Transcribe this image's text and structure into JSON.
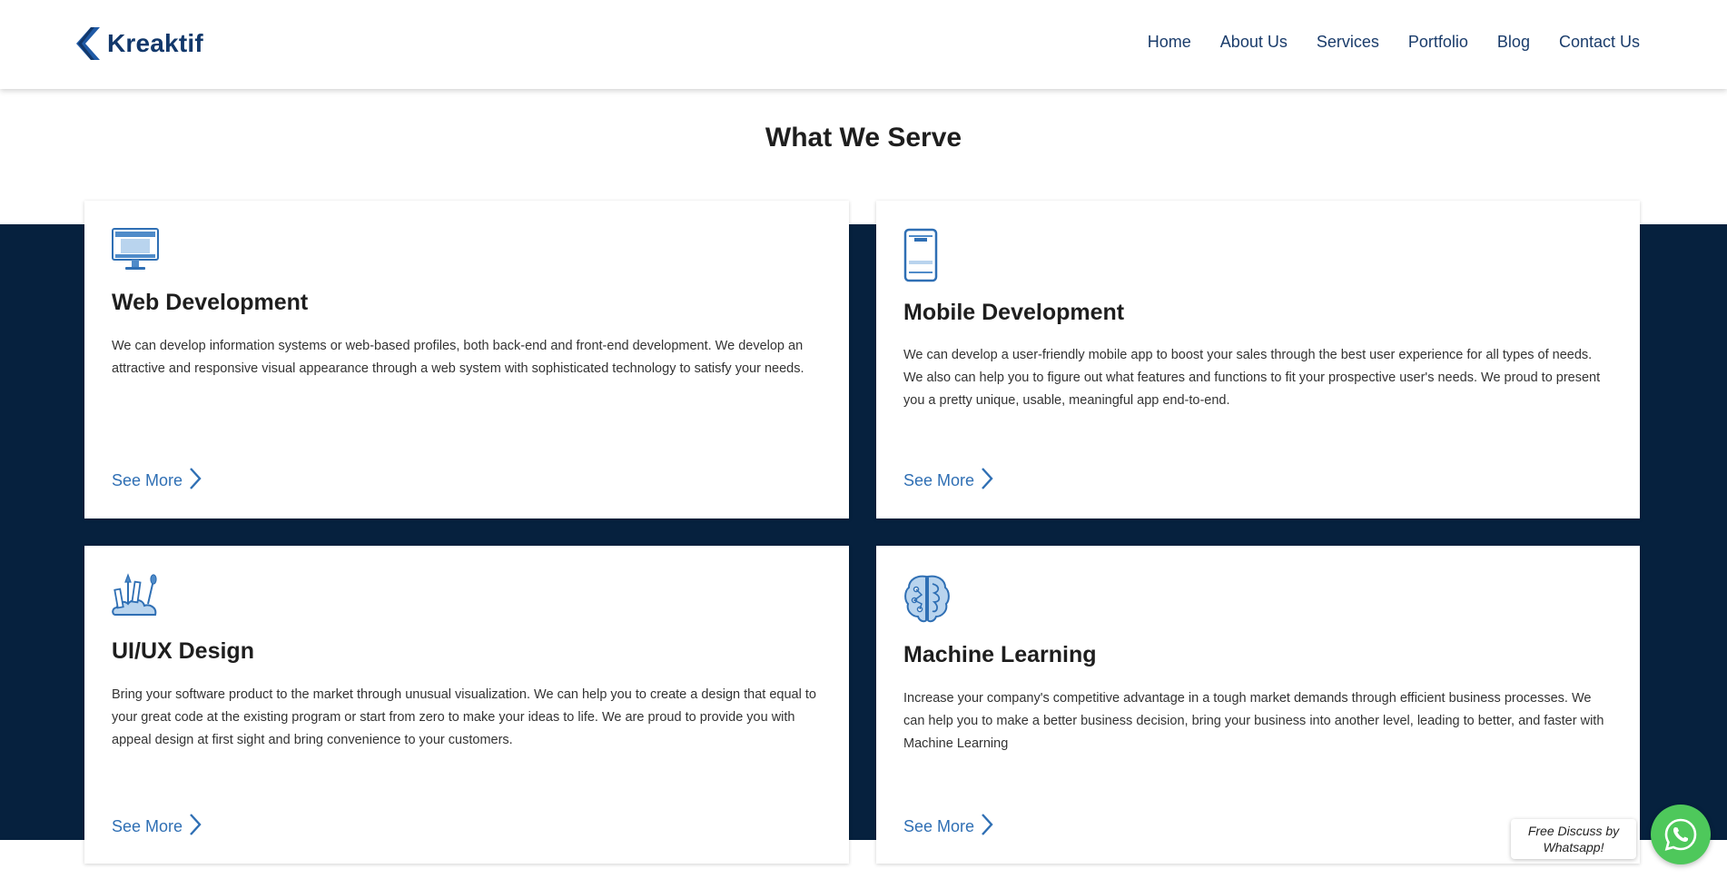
{
  "header": {
    "logo_text": "Kreaktif",
    "nav": [
      "Home",
      "About Us",
      "Services",
      "Portfolio",
      "Blog",
      "Contact Us"
    ]
  },
  "section": {
    "title": "What We Serve"
  },
  "cards": [
    {
      "icon": "monitor-icon",
      "title": "Web Development",
      "description": "We can develop information systems or web-based profiles, both back-end and front-end development. We develop an attractive and responsive visual appearance through a web system with sophisticated technology to satisfy your needs.",
      "link": "See More"
    },
    {
      "icon": "smartphone-icon",
      "title": "Mobile Development",
      "description": "We can develop a user-friendly mobile app to boost your sales through the best user experience for all types of needs. We also can help you to figure out what features and functions to fit your prospective user's needs. We proud to present you a pretty unique, usable, meaningful app end-to-end.",
      "link": "See More"
    },
    {
      "icon": "design-tools-icon",
      "title": "UI/UX Design",
      "description": "Bring your software product to the market through unusual visualization. We can help you to create a design that equal to your great code at the existing program or start from zero to make your ideas to life. We are proud to provide you with appeal design at first sight and bring convenience to your customers.",
      "link": "See More"
    },
    {
      "icon": "brain-icon",
      "title": "Machine Learning",
      "description": "Increase your company's competitive advantage in a tough market demands through efficient business processes. We can help you to make a better business decision, bring your business into another level, leading to better, and faster with Machine Learning",
      "link": "See More"
    }
  ],
  "whatsapp": {
    "label_line1": "Free Discuss by",
    "label_line2": "Whatsapp!"
  },
  "colors": {
    "navy": "#06213e",
    "link": "#2f6fb4",
    "brand": "#12386b",
    "whatsapp": "#4ec85b"
  }
}
